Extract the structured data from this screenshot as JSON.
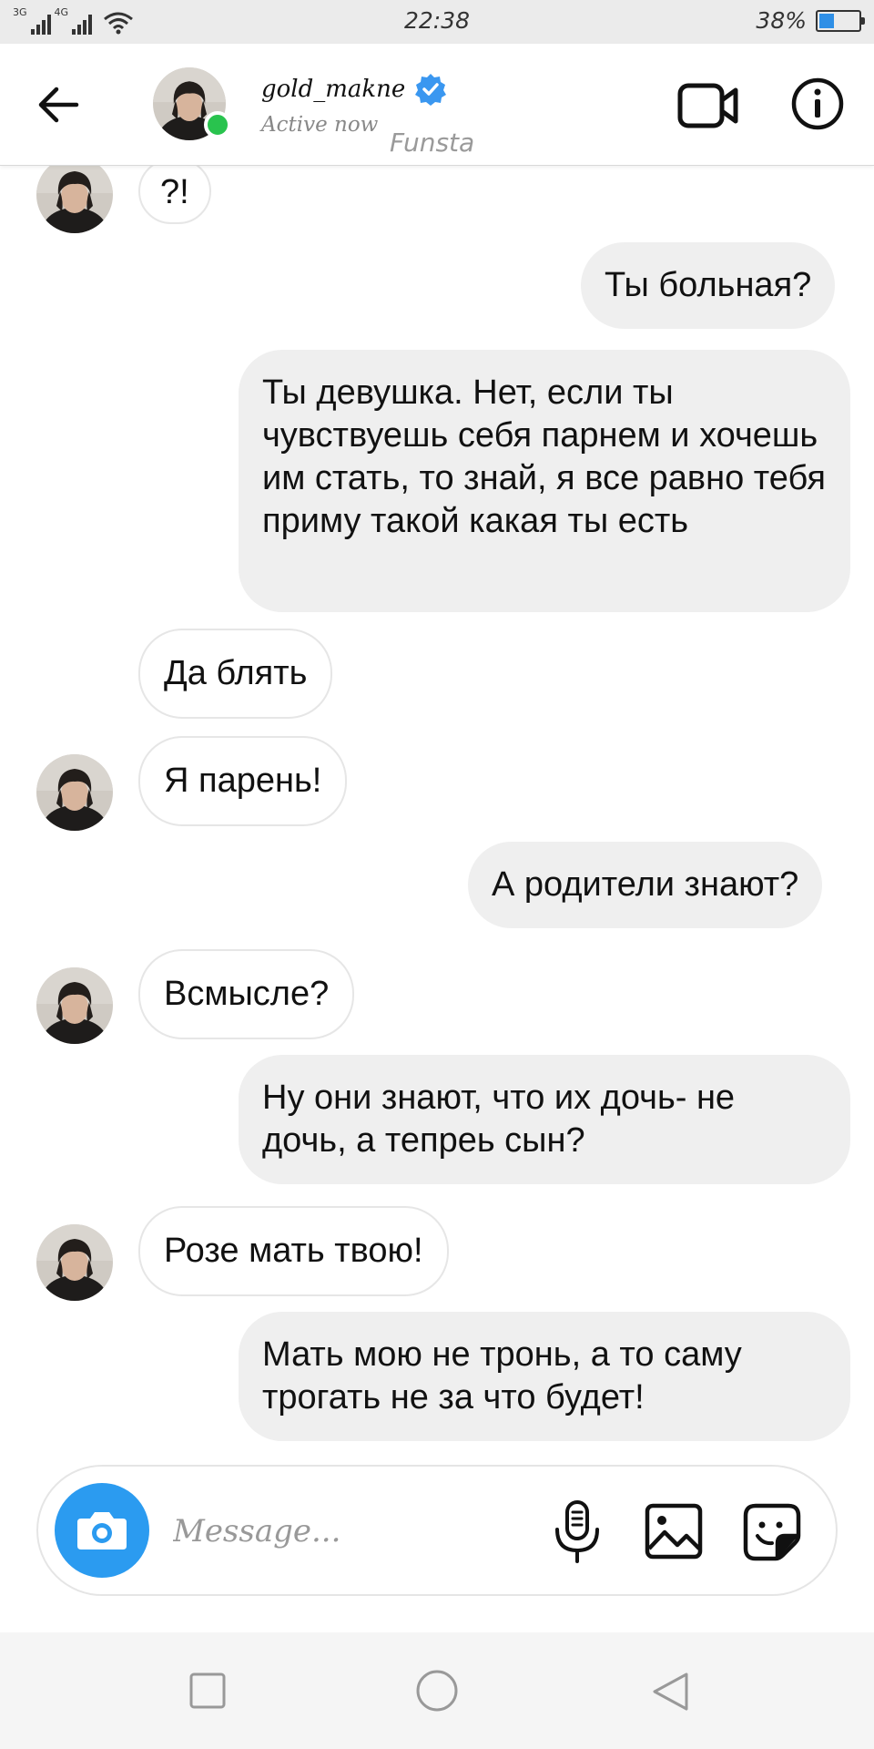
{
  "status_bar": {
    "network_1": "3G",
    "network_2": "4G",
    "time": "22:38",
    "battery_text": "38%",
    "battery_level": 0.38
  },
  "header": {
    "username": "gold_makne",
    "status": "Active now",
    "tag": "Funsta",
    "online_color": "#29c34e",
    "verified_color": "#3a97f0"
  },
  "messages": [
    {
      "side": "in",
      "text": "?!"
    },
    {
      "side": "out",
      "text": "Ты больная?"
    },
    {
      "side": "out",
      "text": "Ты девушка. Нет, если ты чувствуешь себя парнем и хочешь им стать, то знай, я все равно тебя приму такой какая ты есть"
    },
    {
      "side": "in",
      "text": "Да блять"
    },
    {
      "side": "in",
      "text": "Я парень!"
    },
    {
      "side": "out",
      "text": "А родители знают?"
    },
    {
      "side": "in",
      "text": "Всмысле?"
    },
    {
      "side": "out",
      "text": "Ну они знают, что их дочь- не дочь, а тепреь сын?"
    },
    {
      "side": "in",
      "text": "Розе мать твою!"
    },
    {
      "side": "out",
      "text": "Мать мою не тронь, а то саму трогать не за что будет!"
    }
  ],
  "composer": {
    "placeholder": "Message...",
    "camera_color": "#2b9bf0",
    "icons": [
      "camera-icon",
      "microphone-icon",
      "gallery-icon",
      "sticker-icon"
    ]
  },
  "nav": {
    "icons": [
      "recent-apps-icon",
      "home-icon",
      "back-icon"
    ]
  }
}
